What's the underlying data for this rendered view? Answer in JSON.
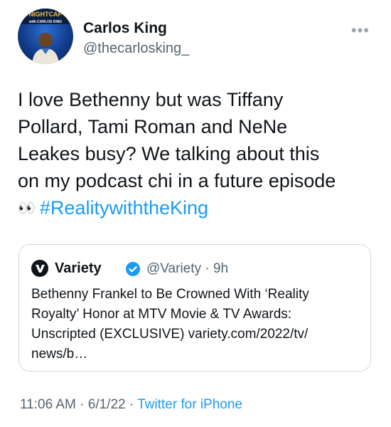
{
  "author": {
    "name": "Carlos King",
    "handle": "@thecarlosking_",
    "avatar_text_top": "NIGHTCAP",
    "avatar_text_bottom": "with CARLOS KING"
  },
  "tweet": {
    "lines": [
      "I love Bethenny but was Tiffany",
      "Pollard, Tami Roman and NeNe",
      "Leakes busy? We talking about this",
      "on my podcast chi in a future episode"
    ],
    "emoji": "👀",
    "hashtag": "#RealitywiththeKing"
  },
  "quote": {
    "name": "Variety",
    "handle_time": "@Variety · 9h",
    "lines": [
      "Bethenny Frankel to Be Crowned With ‘Reality",
      "Royalty’ Honor at MTV Movie & TV Awards:",
      "Unscripted (EXCLUSIVE) variety.com/2022/tv/",
      "news/b…"
    ]
  },
  "footer": {
    "time_date": "11:06 AM · 6/1/22 · ",
    "source": "Twitter for iPhone"
  },
  "colors": {
    "link": "#1d9bf0",
    "secondary": "#536471",
    "verified": "#1d9bf0"
  }
}
